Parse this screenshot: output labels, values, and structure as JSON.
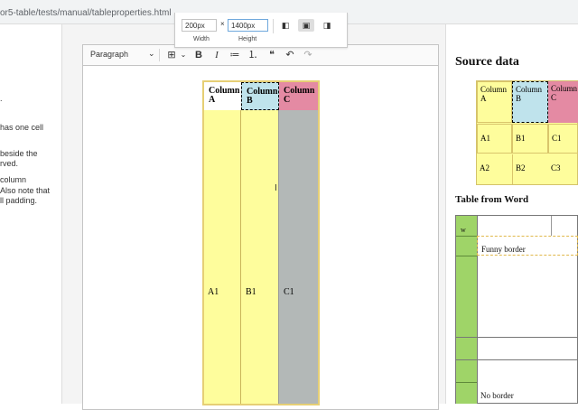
{
  "browser": {
    "url": "or5-table/tests/manual/tableproperties.html"
  },
  "left_text": [
    ".",
    "has one cell",
    "beside the",
    "rved.",
    "column",
    "Also note that",
    "ll padding."
  ],
  "toolbar": {
    "heading_select": "Paragraph",
    "chevron": "⌄",
    "table_icon": "⊞",
    "table_chevron": "⌄",
    "bold": "B",
    "italic": "I",
    "bulleted_list": "≔",
    "numbered_list": "⒈",
    "blockquote": "❝",
    "undo": "↶",
    "redo": "↷"
  },
  "table_properties": {
    "width_value": "200px",
    "times": "×",
    "height_value": "1400px",
    "width_label": "Width",
    "height_label": "Height",
    "align_left": "◧",
    "align_center": "▣",
    "align_right": "◨"
  },
  "editor_table": {
    "headers": [
      "Column A",
      "Column B",
      "Column C"
    ],
    "row": [
      "A1",
      "B1",
      "C1"
    ],
    "colors": {
      "yellow": "#fefd9c",
      "blue": "#bfe3ec",
      "pink": "#e48aa3",
      "gray": "#b3b8b7",
      "border": "#e6cf75"
    }
  },
  "source_data": {
    "title": "Source data",
    "headers": [
      "Column A",
      "Column B",
      "Column C"
    ],
    "row1": [
      "A1",
      "B1",
      "C1"
    ],
    "row2": [
      "A2",
      "B2",
      "C3"
    ]
  },
  "table_from_word": {
    "title": "Table from Word",
    "cell_w": "w",
    "funny_border": "Funny border",
    "no_border": "No border",
    "green": "#9fd468"
  }
}
